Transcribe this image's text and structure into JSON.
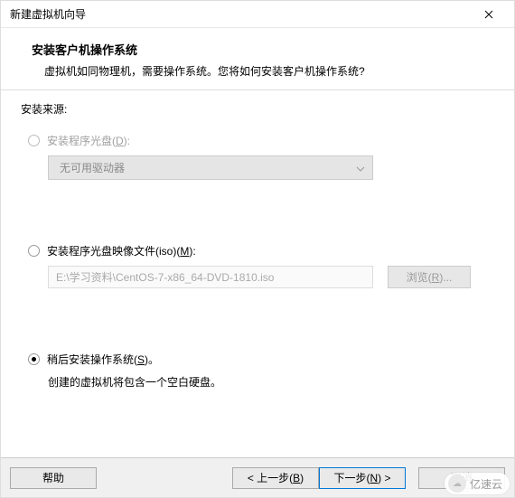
{
  "title": "新建虚拟机向导",
  "header": {
    "title": "安装客户机操作系统",
    "subtitle": "虚拟机如同物理机，需要操作系统。您将如何安装客户机操作系统?"
  },
  "section_label": "安装来源:",
  "options": {
    "disc": {
      "label_pre": "安装程序光盘(",
      "mnemonic": "D",
      "label_post": "):",
      "combo_text": "无可用驱动器"
    },
    "iso": {
      "label_pre": "安装程序光盘映像文件(iso)(",
      "mnemonic": "M",
      "label_post": "):",
      "path": "E:\\学习资料\\CentOS-7-x86_64-DVD-1810.iso",
      "browse_pre": "浏览(",
      "browse_mn": "R",
      "browse_post": ")..."
    },
    "later": {
      "label_pre": "稍后安装操作系统(",
      "mnemonic": "S",
      "label_post": ")。",
      "hint": "创建的虚拟机将包含一个空白硬盘。"
    }
  },
  "buttons": {
    "help": "帮助",
    "back_pre": "< 上一步(",
    "back_mn": "B",
    "back_post": ")",
    "next_pre": "下一步(",
    "next_mn": "N",
    "next_post": ") >",
    "cancel": "取消"
  },
  "watermark": "亿速云"
}
